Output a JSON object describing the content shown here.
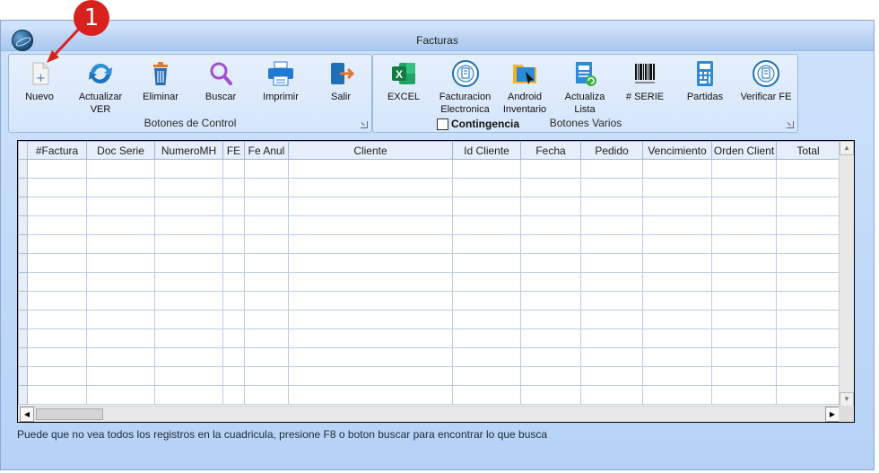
{
  "window": {
    "title": "Facturas"
  },
  "callout": {
    "number": "1",
    "color": "#d8201c"
  },
  "control_group": {
    "caption": "Botones de Control",
    "buttons": [
      {
        "label": "Nuevo",
        "icon": "new-document-icon"
      },
      {
        "label": "Actualizar VER",
        "icon": "refresh-icon"
      },
      {
        "label": "Eliminar",
        "icon": "trash-icon"
      },
      {
        "label": "Buscar",
        "icon": "search-icon"
      },
      {
        "label": "Imprimir",
        "icon": "printer-icon"
      },
      {
        "label": "Salir",
        "icon": "exit-icon"
      }
    ]
  },
  "varios_group": {
    "caption": "Botones Varios",
    "contingencia_label": "Contingencia",
    "buttons": [
      {
        "label": "EXCEL",
        "icon": "excel-icon"
      },
      {
        "label": "Facturacion Electronica",
        "icon": "facturacion-electronica-icon"
      },
      {
        "label": "Android Inventario",
        "icon": "android-inventario-icon"
      },
      {
        "label": "Actualiza Lista",
        "icon": "update-list-icon"
      },
      {
        "label": "# SERIE",
        "icon": "barcode-icon"
      },
      {
        "label": "Partidas",
        "icon": "calculator-icon"
      },
      {
        "label": "Verificar FE",
        "icon": "verificar-fe-icon"
      }
    ]
  },
  "grid": {
    "columns": [
      "#Factura",
      "Doc Serie",
      "NumeroMH",
      "FE",
      "Fe Anul",
      "Cliente",
      "Id Cliente",
      "Fecha",
      "Pedido",
      "Vencimiento",
      "Orden Client",
      "Total"
    ]
  },
  "status_text": "Puede que no vea todos los registros en la cuadricula, presione F8 o boton buscar para encontrar lo que busca",
  "colors": {
    "window_bg": "#b5d2f6",
    "accent": "#2f6fb5"
  }
}
